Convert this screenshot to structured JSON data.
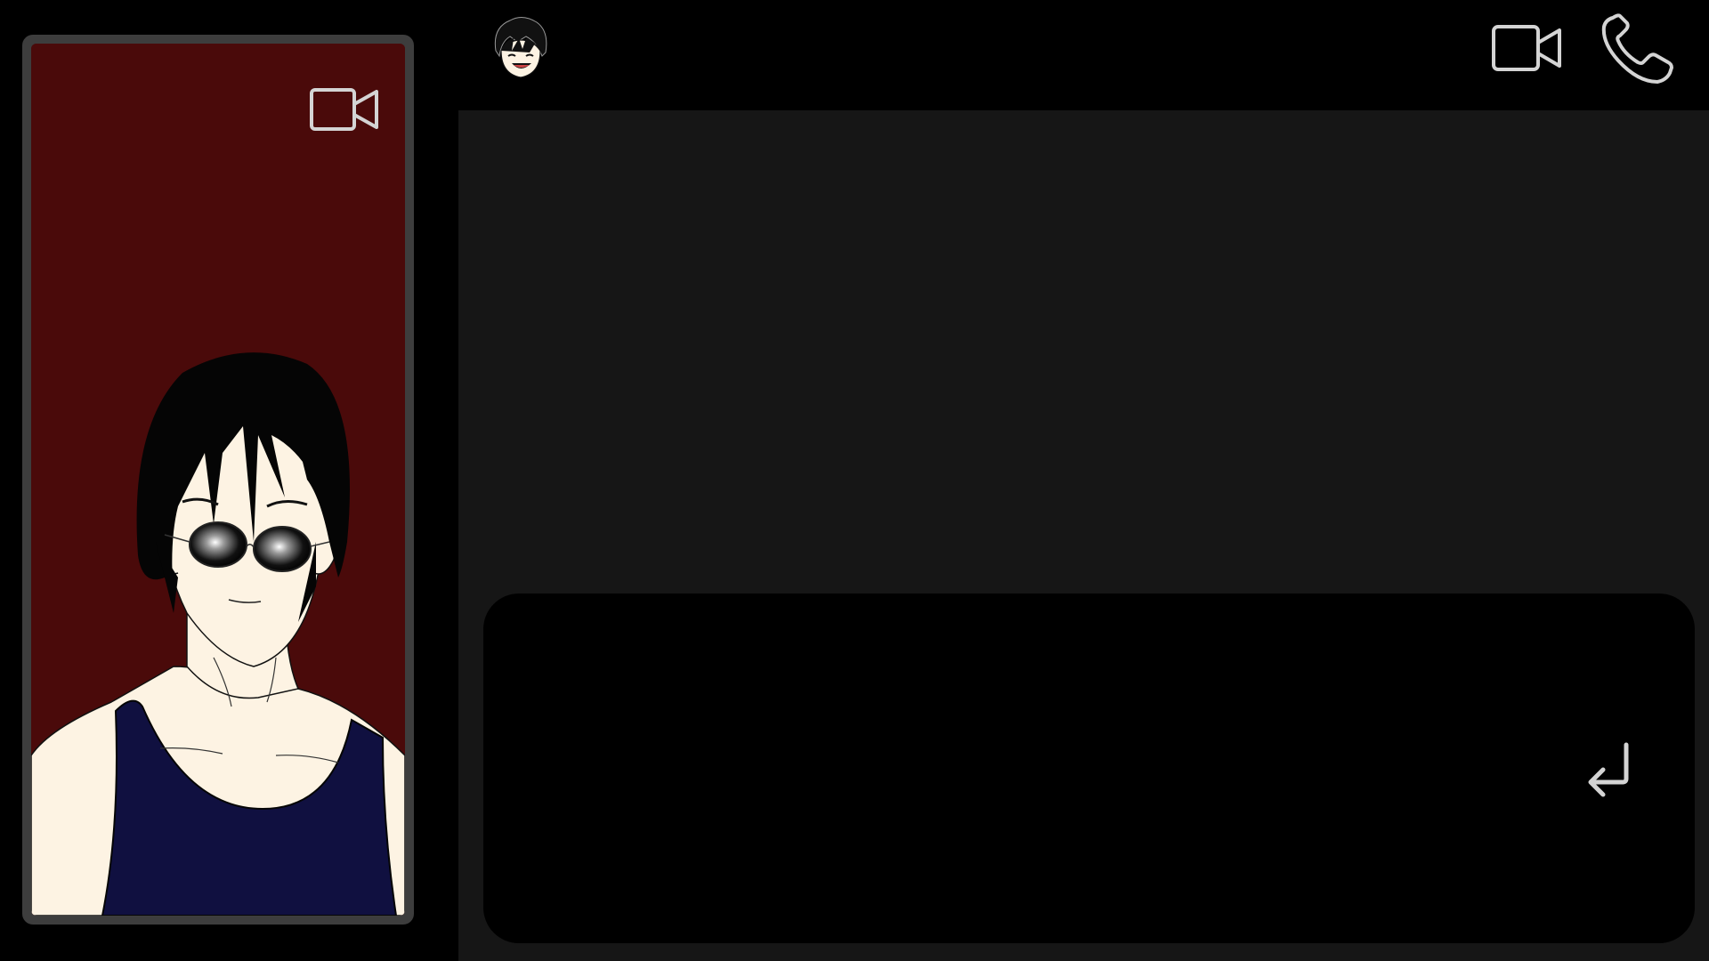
{
  "self_view": {
    "camera_icon": "video-camera-icon",
    "background_color": "#4a0a0a",
    "frame_color": "#3d3d3d"
  },
  "header": {
    "contact_avatar_icon": "contact-avatar",
    "video_call_icon": "video-camera-icon",
    "voice_call_icon": "phone-icon"
  },
  "composer": {
    "input_value": "",
    "placeholder": "",
    "send_icon": "enter-return-icon"
  },
  "colors": {
    "page_background": "#000000",
    "message_area": "#161616",
    "composer_background": "#000000",
    "icon_stroke": "#d4d4d4",
    "skin": "#fdf3e3",
    "shirt": "#101040",
    "hair": "#050505"
  }
}
